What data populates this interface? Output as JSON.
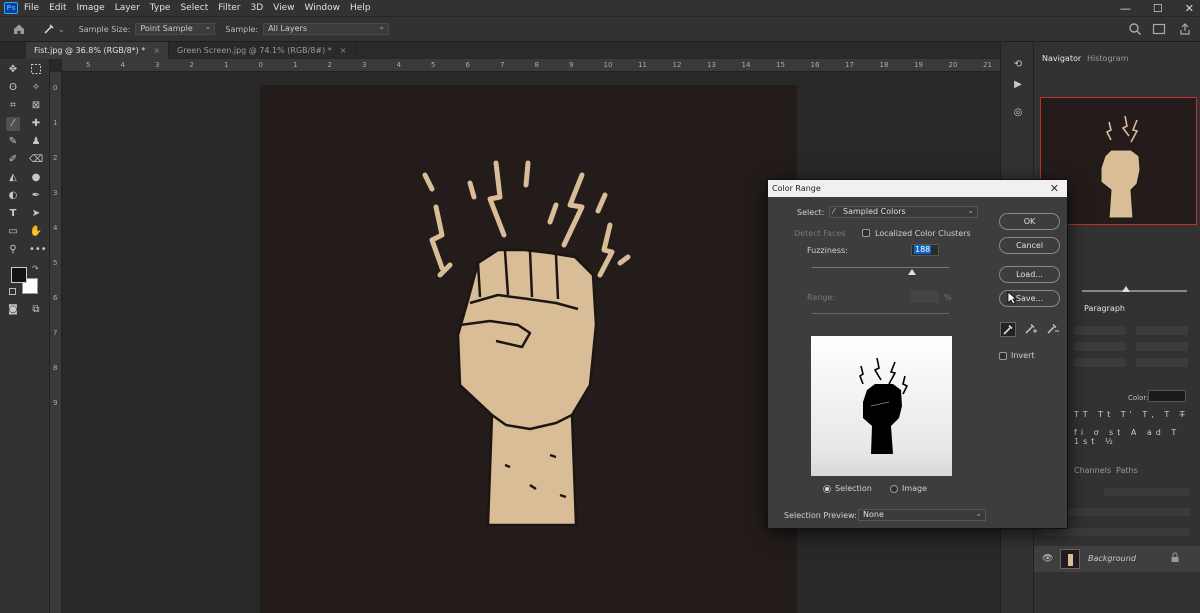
{
  "app": {
    "logo": "Ps"
  },
  "menu": [
    "File",
    "Edit",
    "Image",
    "Layer",
    "Type",
    "Select",
    "Filter",
    "3D",
    "View",
    "Window",
    "Help"
  ],
  "window_controls": [
    "—",
    "☐",
    "✕"
  ],
  "options": {
    "sample_size_label": "Sample Size:",
    "sample_size_value": "Point Sample",
    "sample_label": "Sample:",
    "sample_value": "All Layers"
  },
  "tabs": [
    {
      "label": "Fist.jpg @ 36.8% (RGB/8*) *",
      "close": "×"
    },
    {
      "label": "Green Screen.jpg @ 74.1% (RGB/8#) *",
      "close": "×"
    }
  ],
  "ruler_h": [
    "5",
    "4",
    "3",
    "2",
    "1",
    "0",
    "1",
    "2",
    "3",
    "4",
    "5",
    "6",
    "7",
    "8",
    "9",
    "10",
    "11",
    "12",
    "13",
    "14",
    "15",
    "16",
    "17",
    "18",
    "19",
    "20",
    "21"
  ],
  "ruler_v": [
    "0",
    "1",
    "2",
    "3",
    "4",
    "5",
    "6",
    "7",
    "8",
    "9"
  ],
  "panels": {
    "navigator_tab": "Navigator",
    "histogram_tab": "Histogram",
    "paragraph_tab": "Paragraph",
    "channels_tab": "Channels",
    "paths_tab": "Paths",
    "color_label": "Color:",
    "layer_name": "Background"
  },
  "dialog": {
    "title": "Color Range",
    "close": "✕",
    "select_label": "Select:",
    "select_value": "Sampled Colors",
    "detect_faces": "Detect Faces",
    "localized_clusters": "Localized Color Clusters",
    "fuzziness_label": "Fuzziness:",
    "fuzziness_value": "188",
    "fuzziness_level": 0.73,
    "range_label": "Range:",
    "range_unit": "%",
    "ok": "OK",
    "cancel": "Cancel",
    "load": "Load...",
    "save": "Save...",
    "invert": "Invert",
    "radio_selection": "Selection",
    "radio_image": "Image",
    "preview_label": "Selection Preview:",
    "preview_value": "None"
  },
  "colors": {
    "accent": "#31a8ff",
    "doc_bg": "#231c1b",
    "skin": "#d8bd97",
    "field_highlight": "#0a64c8"
  }
}
